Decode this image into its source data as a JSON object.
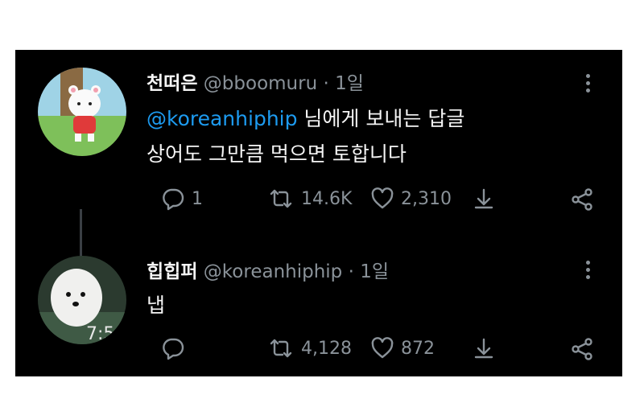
{
  "tweets": [
    {
      "display_name": "천떠은",
      "handle": "@bboomuru",
      "time": "· 1일",
      "reply_mention": "@koreanhiphip",
      "reply_suffix": " 님에게 보내는 답글",
      "text": "상어도 그만큼 먹으면 토합니다",
      "replies": "1",
      "retweets": "14.6K",
      "likes": "2,310"
    },
    {
      "display_name": "힙힙퍼",
      "handle": "@koreanhiphip",
      "time": "· 1일",
      "text": "냅",
      "replies": "",
      "retweets": "4,128",
      "likes": "872"
    }
  ],
  "colors": {
    "background": "#000000",
    "text": "#f5f5f5",
    "muted": "#8a9299",
    "link": "#1d9bf0"
  },
  "icons": [
    "reply-icon",
    "retweet-icon",
    "like-icon",
    "bookmark-icon",
    "share-icon",
    "more-icon"
  ]
}
